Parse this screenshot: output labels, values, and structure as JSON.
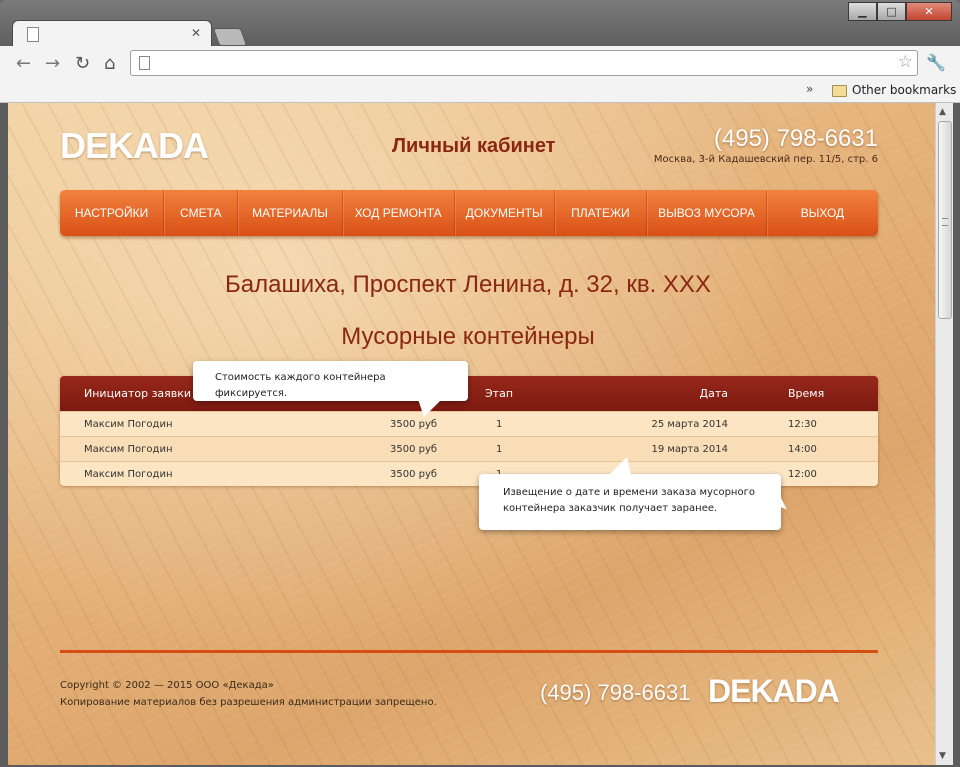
{
  "browser": {
    "bookmarks": {
      "chevron": "»",
      "other_bookmarks": "Other bookmarks"
    },
    "icons": [
      "back-icon",
      "forward-icon",
      "reload-icon",
      "home-icon",
      "page-icon",
      "star-icon",
      "wrench-icon",
      "folder-icon"
    ]
  },
  "site": {
    "logo": "DEKADA",
    "cabinet": "Личный кабинет",
    "phone": "(495) 798-6631",
    "address": "Москва, 3-й Кадашевский пер. 11/5, стр. 6"
  },
  "menu": [
    "НАСТРОЙКИ",
    "СМЕТА",
    "МАТЕРИАЛЫ",
    "ХОД РЕМОНТА",
    "ДОКУМЕНТЫ",
    "ПЛАТЕЖИ",
    "ВЫВОЗ МУСОРА",
    "ВЫХОД"
  ],
  "page": {
    "address_title": "Балашиха, Проспект Ленина, д. 32, кв. XXX",
    "section_title": "Мусорные контейнеры"
  },
  "table": {
    "headers": {
      "initiator": "Инициатор заявки",
      "stage": "Этап",
      "date": "Дата",
      "time": "Время"
    },
    "rows": [
      {
        "initiator": "Максим Погодин",
        "cost": "3500 руб",
        "stage": "1",
        "date": "25 марта 2014",
        "time": "12:30"
      },
      {
        "initiator": "Максим Погодин",
        "cost": "3500 руб",
        "stage": "1",
        "date": "19 марта 2014",
        "time": "14:00"
      },
      {
        "initiator": "Максим Погодин",
        "cost": "3500 руб",
        "stage": "1",
        "date": "",
        "time": "12:00"
      }
    ]
  },
  "callouts": {
    "cost": "Стоимость каждого контейнера фиксируется.",
    "notice_line1": "Извещение о дате и времени заказа мусорного",
    "notice_line2": "контейнера заказчик получает заранее."
  },
  "footer": {
    "copyright": "Copyright © 2002 — 2015 ООО «Декада»",
    "notice": "Копирование материалов без разрешения администрации запрещено.",
    "phone": "(495) 798-6631",
    "logo": "DEKADA"
  },
  "colors": {
    "accent": "#d95016",
    "header_red": "#8a2712",
    "table_head": "#7c1a10"
  }
}
